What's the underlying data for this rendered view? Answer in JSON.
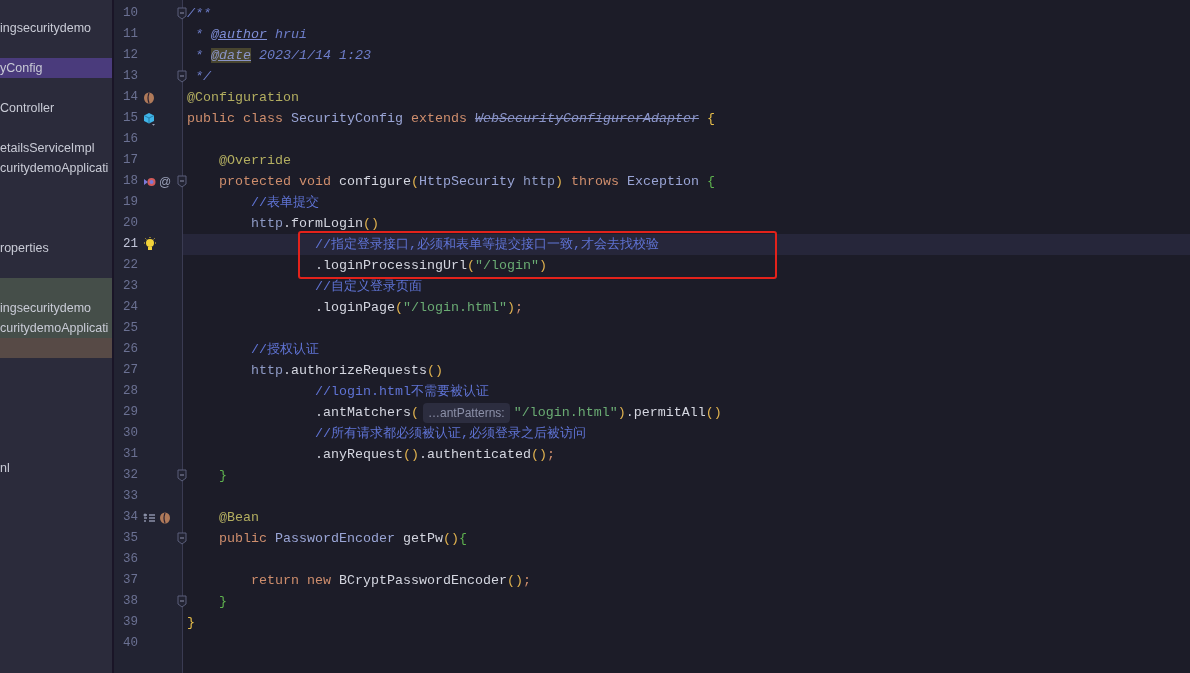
{
  "sidebar": {
    "items": [
      {
        "text": "ingsecuritydemo",
        "selected": false
      },
      {
        "text": "yConfig",
        "selected": true
      },
      {
        "text": "Controller",
        "selected": false
      },
      {
        "text": "etailsServiceImpl",
        "selected": false
      },
      {
        "text": "curitydemoApplicati",
        "selected": false
      },
      {
        "text": "roperties",
        "selected": false
      },
      {
        "text": "ingsecuritydemo",
        "selected": false
      },
      {
        "text": "curitydemoApplicati",
        "selected": false
      },
      {
        "text": "nl",
        "selected": false
      }
    ]
  },
  "editor": {
    "lines": [
      {
        "number": "10",
        "current": false,
        "fold": true,
        "boxed": false,
        "segments": [
          {
            "kind": "code",
            "tokens": [
              {
                "kind": "doc",
                "text": "/**"
              }
            ]
          }
        ]
      },
      {
        "number": "11",
        "current": false,
        "fold": false,
        "boxed": false,
        "segments": [
          {
            "kind": "code",
            "tokens": [
              {
                "kind": "doc",
                "text": " * "
              },
              {
                "kind": "doctag",
                "text": "@author"
              },
              {
                "kind": "doc",
                "text": " hrui"
              }
            ]
          }
        ]
      },
      {
        "number": "12",
        "current": false,
        "fold": false,
        "boxed": false,
        "segments": [
          {
            "kind": "code",
            "tokens": [
              {
                "kind": "doc",
                "text": " * "
              },
              {
                "kind": "doctagmark",
                "text": "@date"
              },
              {
                "kind": "doc",
                "text": " 2023/1/14 1:23"
              }
            ]
          }
        ]
      },
      {
        "number": "13",
        "current": false,
        "fold": true,
        "boxed": false,
        "segments": [
          {
            "kind": "code",
            "tokens": [
              {
                "kind": "doc",
                "text": " */"
              }
            ]
          }
        ]
      },
      {
        "number": "14",
        "current": false,
        "fold": false,
        "boxed": false,
        "segments": [
          {
            "kind": "code",
            "tokens": [
              {
                "kind": "ann",
                "text": "@Configuration"
              }
            ]
          }
        ]
      },
      {
        "number": "15",
        "current": false,
        "fold": false,
        "boxed": false,
        "segments": [
          {
            "kind": "code",
            "tokens": [
              {
                "kind": "kw",
                "text": "public class "
              },
              {
                "kind": "type",
                "text": "SecurityConfig "
              },
              {
                "kind": "kw",
                "text": "extends "
              },
              {
                "kind": "deprecated",
                "text": "WebSecurityConfigurerAdapter"
              },
              {
                "kind": "brace",
                "text": " {"
              }
            ]
          }
        ]
      },
      {
        "number": "16",
        "current": false,
        "fold": false,
        "boxed": false
      },
      {
        "number": "17",
        "current": false,
        "fold": false,
        "boxed": false,
        "segments": [
          {
            "kind": "code",
            "tokens": [
              {
                "kind": "ann",
                "text": "    @Override"
              }
            ]
          }
        ]
      },
      {
        "number": "18",
        "current": false,
        "fold": true,
        "boxed": false,
        "gutter_symbol": "@",
        "segments": [
          {
            "kind": "code",
            "tokens": [
              {
                "kind": "kw",
                "text": "    protected void "
              },
              {
                "kind": "fn",
                "text": "configure"
              },
              {
                "kind": "paren",
                "text": "("
              },
              {
                "kind": "type",
                "text": "HttpSecurity "
              },
              {
                "kind": "id",
                "text": "http"
              },
              {
                "kind": "paren",
                "text": ") "
              },
              {
                "kind": "kw",
                "text": "throws "
              },
              {
                "kind": "type",
                "text": "Exception "
              },
              {
                "kind": "brace2",
                "text": "{"
              }
            ]
          }
        ]
      },
      {
        "number": "19",
        "current": false,
        "fold": false,
        "boxed": false,
        "segments": [
          {
            "kind": "code",
            "tokens": [
              {
                "kind": "cmt",
                "text": "        //表单提交"
              }
            ]
          }
        ]
      },
      {
        "number": "20",
        "current": false,
        "fold": false,
        "boxed": false,
        "segments": [
          {
            "kind": "code",
            "tokens": [
              {
                "kind": "id",
                "text": "        http"
              },
              {
                "kind": "plain",
                "text": "."
              },
              {
                "kind": "fn",
                "text": "formLogin"
              },
              {
                "kind": "paren",
                "text": "()"
              }
            ]
          }
        ]
      },
      {
        "number": "21",
        "current": true,
        "fold": false,
        "boxed": true,
        "segments": [
          {
            "kind": "code",
            "tokens": [
              {
                "kind": "cmt",
                "text": "                //指定登录接口,必须和表单等提交接口一致,才会去找校验"
              }
            ]
          }
        ]
      },
      {
        "number": "22",
        "current": false,
        "fold": false,
        "boxed": true,
        "segments": [
          {
            "kind": "code",
            "tokens": [
              {
                "kind": "plain",
                "text": "                ."
              },
              {
                "kind": "fn",
                "text": "loginProcessingUrl"
              },
              {
                "kind": "paren",
                "text": "("
              },
              {
                "kind": "str",
                "text": "\"/login\""
              },
              {
                "kind": "paren",
                "text": ")"
              }
            ]
          }
        ]
      },
      {
        "number": "23",
        "current": false,
        "fold": false,
        "boxed": false,
        "segments": [
          {
            "kind": "code",
            "tokens": [
              {
                "kind": "cmt",
                "text": "                //自定义登录页面"
              }
            ]
          }
        ]
      },
      {
        "number": "24",
        "current": false,
        "fold": false,
        "boxed": false,
        "segments": [
          {
            "kind": "code",
            "tokens": [
              {
                "kind": "plain",
                "text": "                ."
              },
              {
                "kind": "fn",
                "text": "loginPage"
              },
              {
                "kind": "paren",
                "text": "("
              },
              {
                "kind": "str",
                "text": "\"/login.html\""
              },
              {
                "kind": "paren",
                "text": ")"
              },
              {
                "kind": "semi",
                "text": ";"
              }
            ]
          }
        ]
      },
      {
        "number": "25",
        "current": false,
        "fold": false,
        "boxed": false
      },
      {
        "number": "26",
        "current": false,
        "fold": false,
        "boxed": false,
        "segments": [
          {
            "kind": "code",
            "tokens": [
              {
                "kind": "cmt",
                "text": "        //授权认证"
              }
            ]
          }
        ]
      },
      {
        "number": "27",
        "current": false,
        "fold": false,
        "boxed": false,
        "segments": [
          {
            "kind": "code",
            "tokens": [
              {
                "kind": "id",
                "text": "        http"
              },
              {
                "kind": "plain",
                "text": "."
              },
              {
                "kind": "fn",
                "text": "authorizeRequests"
              },
              {
                "kind": "paren",
                "text": "()"
              }
            ]
          }
        ]
      },
      {
        "number": "28",
        "current": false,
        "fold": false,
        "boxed": false,
        "segments": [
          {
            "kind": "code",
            "tokens": [
              {
                "kind": "cmt",
                "text": "                //login.html不需要被认证"
              }
            ]
          }
        ]
      },
      {
        "number": "29",
        "current": false,
        "fold": false,
        "boxed": false,
        "segments": [
          {
            "kind": "code",
            "tokens": [
              {
                "kind": "plain",
                "text": "                ."
              },
              {
                "kind": "fn",
                "text": "antMatchers"
              },
              {
                "kind": "paren",
                "text": "("
              }
            ]
          },
          {
            "kind": "hint",
            "text": "…antPatterns:"
          },
          {
            "kind": "code",
            "tokens": [
              {
                "kind": "str",
                "text": "\"/login.html\""
              },
              {
                "kind": "paren",
                "text": ")"
              },
              {
                "kind": "plain",
                "text": "."
              },
              {
                "kind": "fn",
                "text": "permitAll"
              },
              {
                "kind": "paren",
                "text": "()"
              }
            ]
          }
        ]
      },
      {
        "number": "30",
        "current": false,
        "fold": false,
        "boxed": false,
        "segments": [
          {
            "kind": "code",
            "tokens": [
              {
                "kind": "cmt",
                "text": "                //所有请求都必须被认证,必须登录之后被访问"
              }
            ]
          }
        ]
      },
      {
        "number": "31",
        "current": false,
        "fold": false,
        "boxed": false,
        "segments": [
          {
            "kind": "code",
            "tokens": [
              {
                "kind": "plain",
                "text": "                ."
              },
              {
                "kind": "fn",
                "text": "anyRequest"
              },
              {
                "kind": "paren",
                "text": "()"
              },
              {
                "kind": "plain",
                "text": "."
              },
              {
                "kind": "fn",
                "text": "authenticated"
              },
              {
                "kind": "paren",
                "text": "()"
              },
              {
                "kind": "semi",
                "text": ";"
              }
            ]
          }
        ]
      },
      {
        "number": "32",
        "current": false,
        "fold": true,
        "boxed": false,
        "segments": [
          {
            "kind": "code",
            "tokens": [
              {
                "kind": "brace2",
                "text": "    }"
              }
            ]
          }
        ]
      },
      {
        "number": "33",
        "current": false,
        "fold": false,
        "boxed": false
      },
      {
        "number": "34",
        "current": false,
        "fold": false,
        "boxed": false,
        "segments": [
          {
            "kind": "code",
            "tokens": [
              {
                "kind": "ann",
                "text": "    @Bean"
              }
            ]
          }
        ]
      },
      {
        "number": "35",
        "current": false,
        "fold": true,
        "boxed": false,
        "segments": [
          {
            "kind": "code",
            "tokens": [
              {
                "kind": "kw",
                "text": "    public "
              },
              {
                "kind": "type",
                "text": "PasswordEncoder "
              },
              {
                "kind": "fn",
                "text": "getPw"
              },
              {
                "kind": "paren",
                "text": "()"
              },
              {
                "kind": "brace2",
                "text": "{"
              }
            ]
          }
        ]
      },
      {
        "number": "36",
        "current": false,
        "fold": false,
        "boxed": false
      },
      {
        "number": "37",
        "current": false,
        "fold": false,
        "boxed": false,
        "segments": [
          {
            "kind": "code",
            "tokens": [
              {
                "kind": "kw",
                "text": "        return new "
              },
              {
                "kind": "fn",
                "text": "BCryptPasswordEncoder"
              },
              {
                "kind": "paren",
                "text": "()"
              },
              {
                "kind": "semi",
                "text": ";"
              }
            ]
          }
        ]
      },
      {
        "number": "38",
        "current": false,
        "fold": true,
        "boxed": false,
        "segments": [
          {
            "kind": "code",
            "tokens": [
              {
                "kind": "brace2",
                "text": "    }"
              }
            ]
          }
        ]
      },
      {
        "number": "39",
        "current": false,
        "fold": false,
        "boxed": false,
        "segments": [
          {
            "kind": "code",
            "tokens": [
              {
                "kind": "brace",
                "text": "}"
              }
            ]
          }
        ]
      },
      {
        "number": "40",
        "current": false,
        "fold": false,
        "boxed": false
      }
    ]
  }
}
